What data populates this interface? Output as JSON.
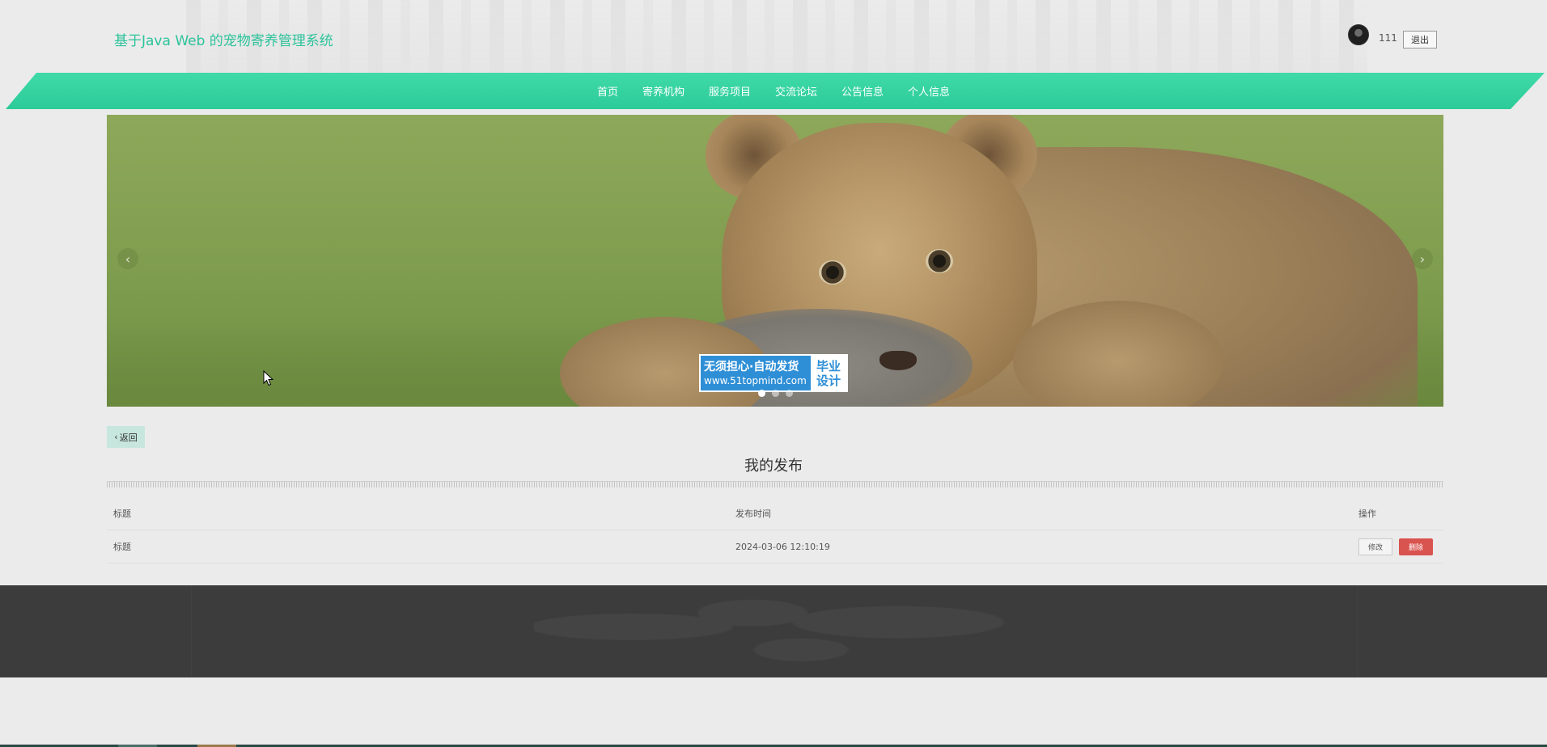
{
  "header": {
    "site_title": "基于Java Web 的宠物寄养管理系统",
    "username": "111",
    "logout_label": "退出"
  },
  "nav": {
    "items": [
      "首页",
      "寄养机构",
      "服务项目",
      "交流论坛",
      "公告信息",
      "个人信息"
    ]
  },
  "banner": {
    "prev_arrow": "‹",
    "next_arrow": "›",
    "slide_count": 3,
    "active_slide": 1,
    "watermark": {
      "line1": "无须担心·自动发货",
      "line2": "www.51topmind.com",
      "tag_line1": "毕业",
      "tag_line2": "设计"
    }
  },
  "content": {
    "back_label": "返回",
    "section_title": "我的发布",
    "table": {
      "headers": [
        "标题",
        "发布时间",
        "操作"
      ],
      "rows": [
        {
          "title": "标题",
          "time": "2024-03-06 12:10:19",
          "edit_label": "修改",
          "delete_label": "删除"
        }
      ]
    }
  },
  "colors": {
    "accent": "#2dc39b",
    "nav_bg": "#36d3a1",
    "delete": "#d9534f",
    "footer": "#3c3c3c"
  }
}
